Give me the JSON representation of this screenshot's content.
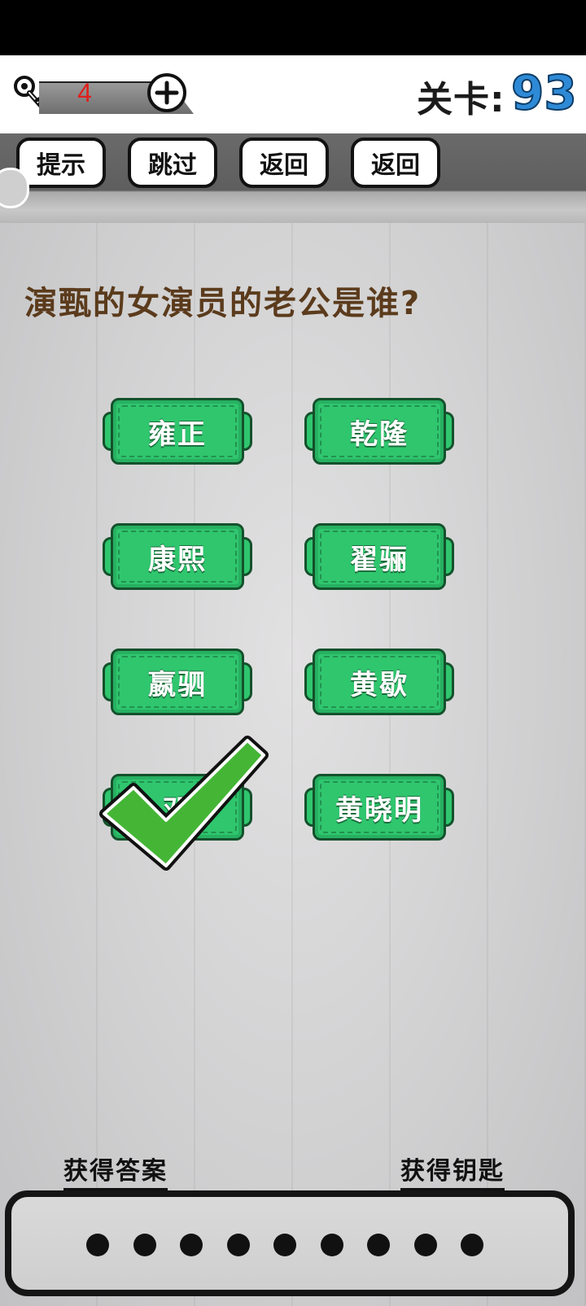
{
  "header": {
    "key_count": "4",
    "level_label": "关卡:",
    "level_number": "93"
  },
  "toolbar": {
    "hint": "提示",
    "skip": "跳过",
    "back1": "返回",
    "back2": "返回"
  },
  "question": "演甄的女演员的老公是谁?",
  "options": [
    "雍正",
    "乾隆",
    "康熙",
    "翟骊",
    "嬴驷",
    "黄歇",
    "邓",
    "黄晓明"
  ],
  "footer": {
    "get_answer": "获得答案",
    "get_key": "获得钥匙"
  },
  "answer_slots": 9,
  "colors": {
    "option_green": "#2fc66e",
    "check_green": "#45b536",
    "question_brown": "#5b3b1c",
    "level_blue": "#2e8ad6",
    "key_red": "#e0201b"
  }
}
